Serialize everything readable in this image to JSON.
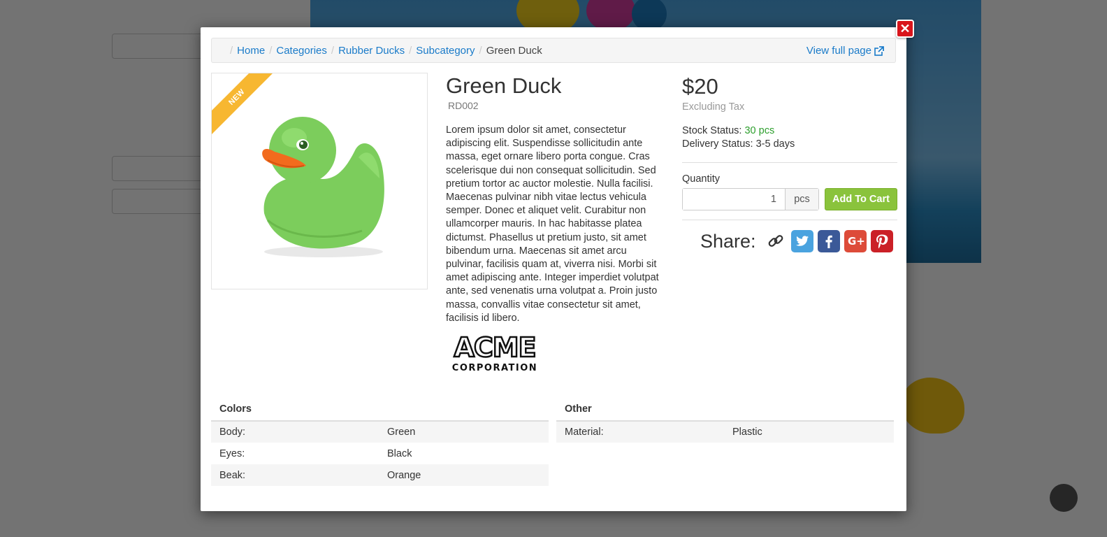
{
  "modal": {
    "close_symbol": "✕",
    "breadcrumb": [
      {
        "label": "Home"
      },
      {
        "label": "Categories"
      },
      {
        "label": "Rubber Ducks"
      },
      {
        "label": "Subcategory"
      }
    ],
    "breadcrumb_active": "Green Duck",
    "view_full_label": "View full page",
    "product": {
      "badge": "NEW",
      "title": "Green Duck",
      "sku": "RD002",
      "description": "Lorem ipsum dolor sit amet, consectetur adipiscing elit. Suspendisse sollicitudin ante massa, eget ornare libero porta congue. Cras scelerisque dui non consequat sollicitudin. Sed pretium tortor ac auctor molestie. Nulla facilisi. Maecenas pulvinar nibh vitae lectus vehicula semper. Donec et aliquet velit. Curabitur non ullamcorper mauris. In hac habitasse platea dictumst. Phasellus ut pretium justo, sit amet bibendum urna. Maecenas sit amet arcu pulvinar, facilisis quam at, viverra nisi. Morbi sit amet adipiscing ante. Integer imperdiet volutpat ante, sed venenatis urna volutpat a. Proin justo massa, convallis vitae consectetur sit amet, facilisis id libero.",
      "manufacturer": {
        "name_line1": "ACME",
        "name_line2": "CORPORATION"
      },
      "price": "$20",
      "tax_note": "Excluding Tax",
      "stock_label": "Stock Status:",
      "stock_value": "30 pcs",
      "delivery_label": "Delivery Status:",
      "delivery_value": "3-5 days",
      "quantity_label": "Quantity",
      "quantity_value": "1",
      "quantity_unit": "pcs",
      "add_to_cart_label": "Add To Cart",
      "share_label": "Share:",
      "share_icons": [
        "link-icon",
        "twitter-icon",
        "facebook-icon",
        "google-plus-icon",
        "pinterest-icon"
      ]
    },
    "specs": {
      "colors": {
        "heading": "Colors",
        "rows": [
          {
            "key": "Body:",
            "value": "Green"
          },
          {
            "key": "Eyes:",
            "value": "Black"
          },
          {
            "key": "Beak:",
            "value": "Orange"
          }
        ]
      },
      "other": {
        "heading": "Other",
        "rows": [
          {
            "key": "Material:",
            "value": "Plastic"
          }
        ]
      }
    }
  },
  "colors": {
    "link": "#1a7bc9",
    "stock_ok": "#2c9e2c",
    "cart_button": "#8ac33c",
    "badge": "#f7b731",
    "close": "#d9151c",
    "duck_green": "#7ccd5c",
    "beak_orange": "#f26b1d"
  }
}
